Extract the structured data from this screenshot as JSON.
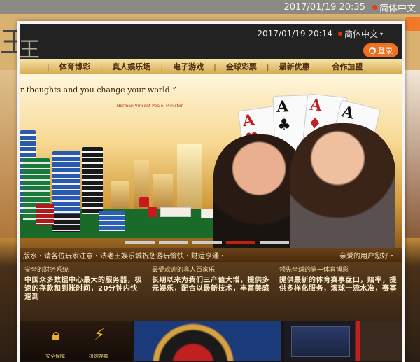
{
  "backdrop": {
    "datetime": "2017/01/19 20:35",
    "language": "简体中文",
    "logo_fragment": "王"
  },
  "topbar": {
    "datetime": "2017/01/19 20:14",
    "language": "简体中文",
    "lang_dot_color": "#e03010"
  },
  "header": {
    "logo_text": "王",
    "login_label": "登录",
    "login_icon": "user-icon"
  },
  "nav": {
    "items": [
      "体育博彩",
      "真人娱乐场",
      "电子游戏",
      "全球彩票",
      "最新优惠",
      "合作加盟"
    ]
  },
  "banner": {
    "quote": "r thoughts and you change your world.”",
    "quote_by": "— Norman Vincent Peale, Minister",
    "pager_count": 5,
    "pager_active_index": 3
  },
  "ticker": {
    "left": "版水・请各位玩家注意・法老王娱乐城祝您游玩愉快・财运亨通・",
    "right": "亲爱的用户您好・"
  },
  "features": [
    {
      "title": "安全的财务系统",
      "body": "中国众多数据中心最大的服务器，极速的存款和到账时间，20分钟内快速到"
    },
    {
      "title": "最受欢迎的真人百家乐",
      "body": "长期以来为我们三产值大增，提供多元娱乐，配合以最新技术，丰富美感"
    },
    {
      "title": "领先全球的第一体育博彩",
      "body": "提供最新的体育赛事盘口，赔率，提供多样化服务，滚球一流水准，赛事"
    }
  ],
  "tiles": {
    "tile1_labels": [
      "安全保障",
      "极速存款"
    ],
    "tile1_icons": [
      "lock-icon",
      "lightning-icon"
    ]
  },
  "colors": {
    "accent_orange": "#f07020",
    "nav_gold": "#d6a850",
    "ticker_brown": "#5a3414",
    "pager_active": "#c02010"
  }
}
